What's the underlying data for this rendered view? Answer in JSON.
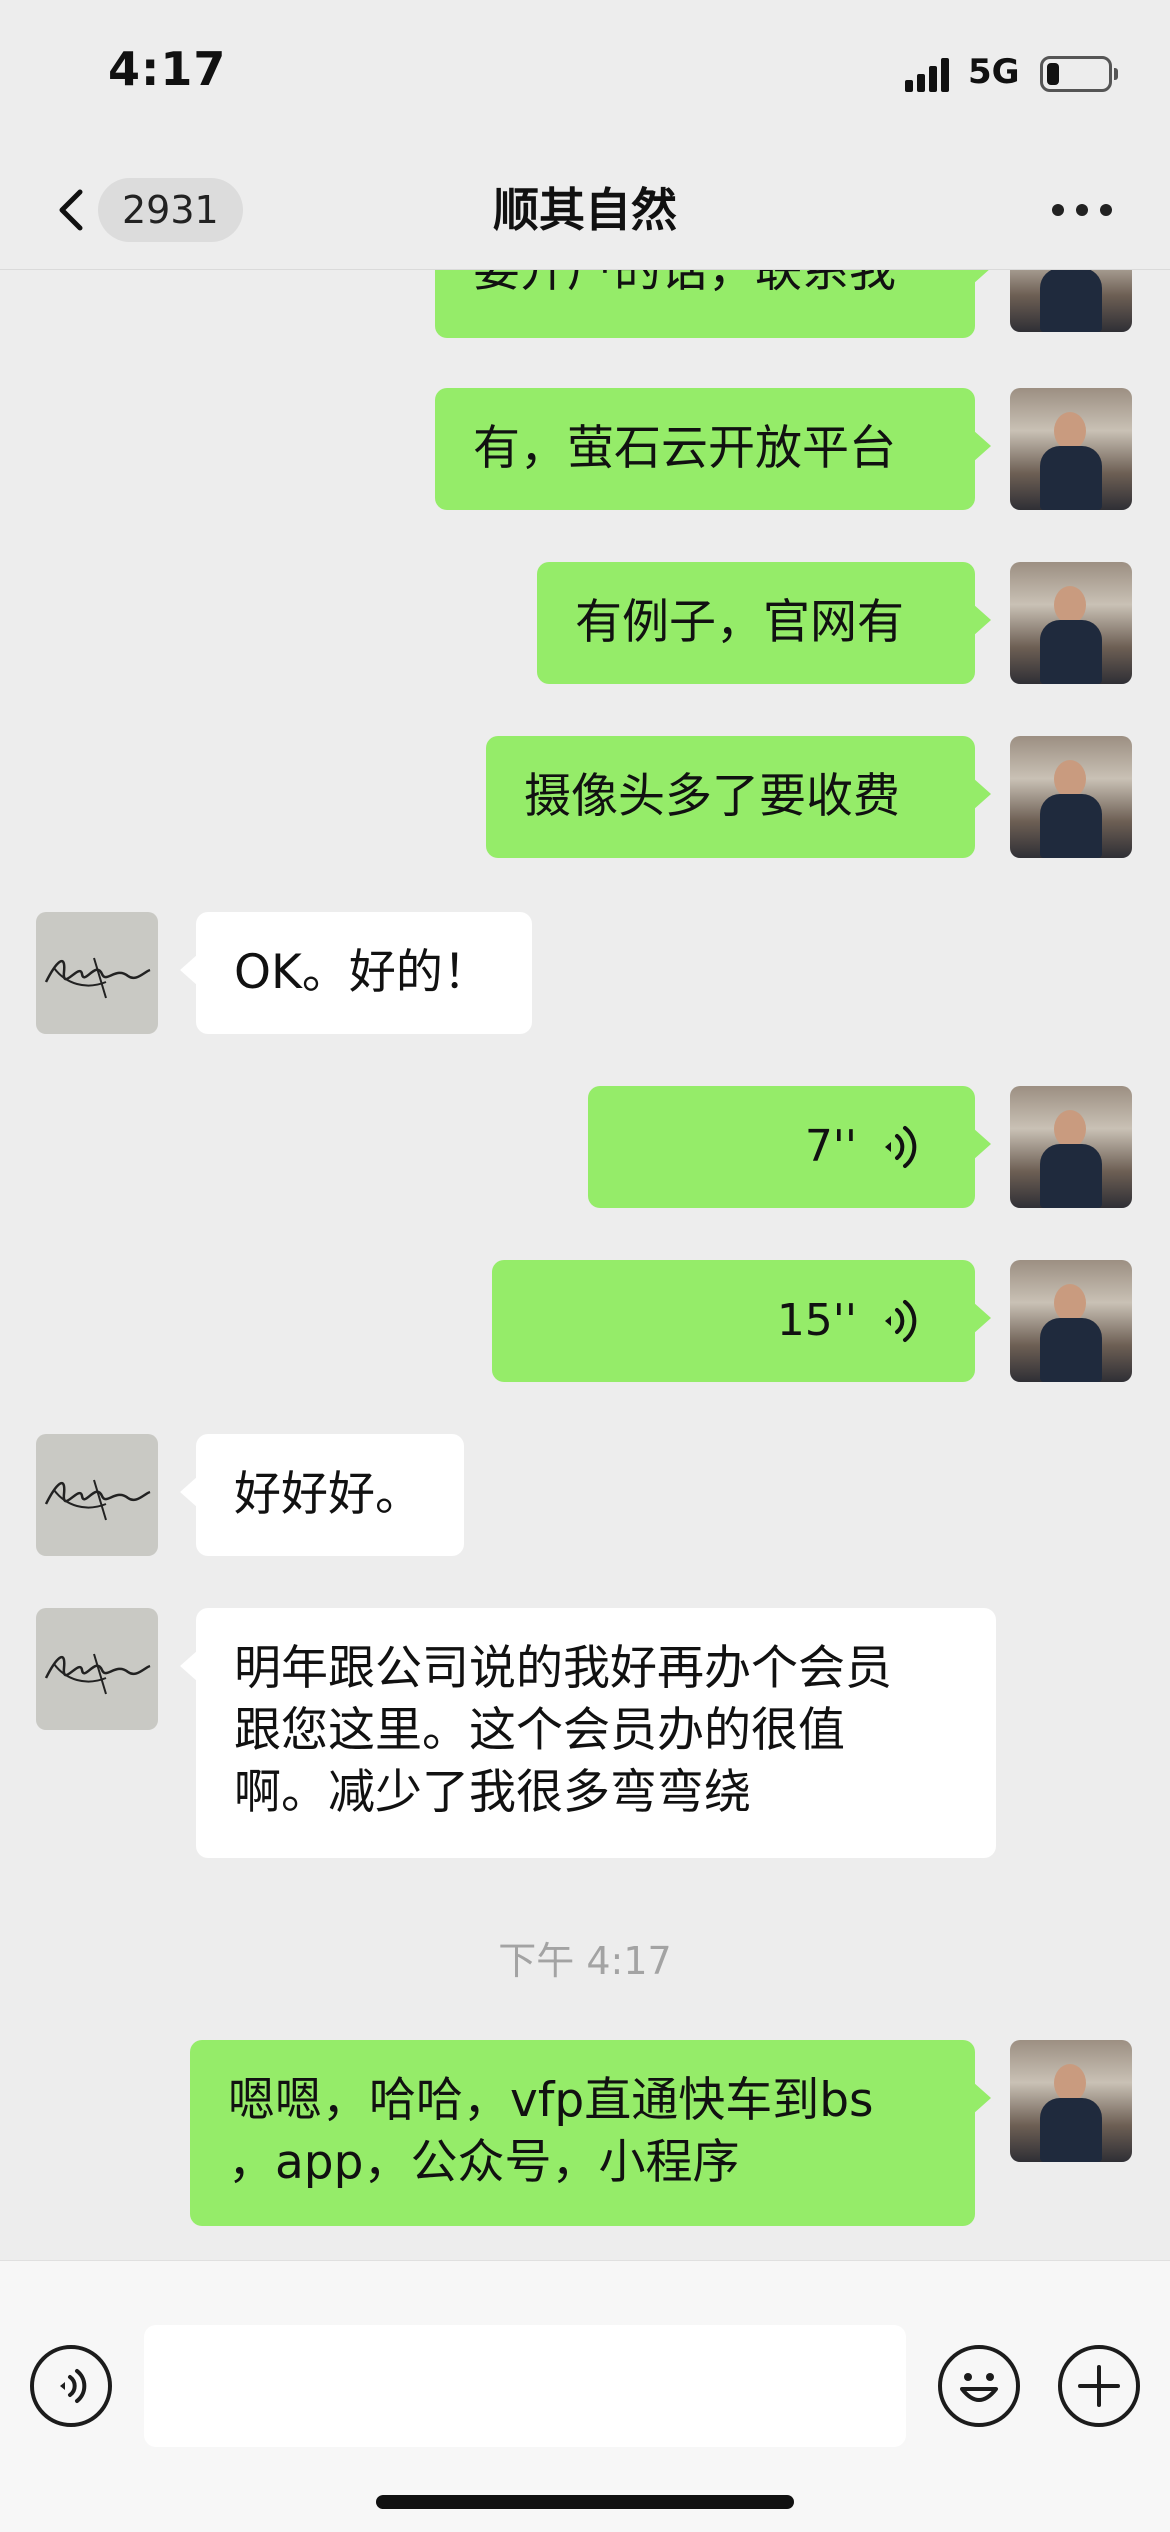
{
  "status_bar": {
    "time": "4:17",
    "network": "5G",
    "battery_level": 0.2
  },
  "nav": {
    "unread_count": "2931",
    "title": "顺其自然",
    "back_icon": "chevron-left-icon",
    "more_icon": "more-dots-icon"
  },
  "messages": [
    {
      "sender": "me",
      "type": "text",
      "text": "要开户的话，联系我"
    },
    {
      "sender": "me",
      "type": "text",
      "text": "有，萤石云开放平台"
    },
    {
      "sender": "me",
      "type": "text",
      "text": "有例子，官网有"
    },
    {
      "sender": "me",
      "type": "text",
      "text": "摄像头多了要收费"
    },
    {
      "sender": "them",
      "type": "text",
      "text": "OK。好的！"
    },
    {
      "sender": "me",
      "type": "voice",
      "duration": "7''"
    },
    {
      "sender": "me",
      "type": "voice",
      "duration": "15''"
    },
    {
      "sender": "them",
      "type": "text",
      "text": "好好好。"
    },
    {
      "sender": "them",
      "type": "text",
      "text": "明年跟公司说的我好再办个会员\n跟您这里。这个会员办的很值\n啊。减少了我很多弯弯绕"
    },
    {
      "sender": "me",
      "type": "text",
      "text": "嗯嗯，哈哈，vfp直通快车到bs\n，app，公众号，小程序"
    }
  ],
  "timestamp": "下午 4:17",
  "input_bar": {
    "voice_icon": "voice-input-icon",
    "emoji_icon": "emoji-icon",
    "plus_icon": "plus-icon",
    "input_value": ""
  },
  "colors": {
    "background": "#ededed",
    "my_bubble": "#95ec69",
    "their_bubble": "#ffffff"
  }
}
